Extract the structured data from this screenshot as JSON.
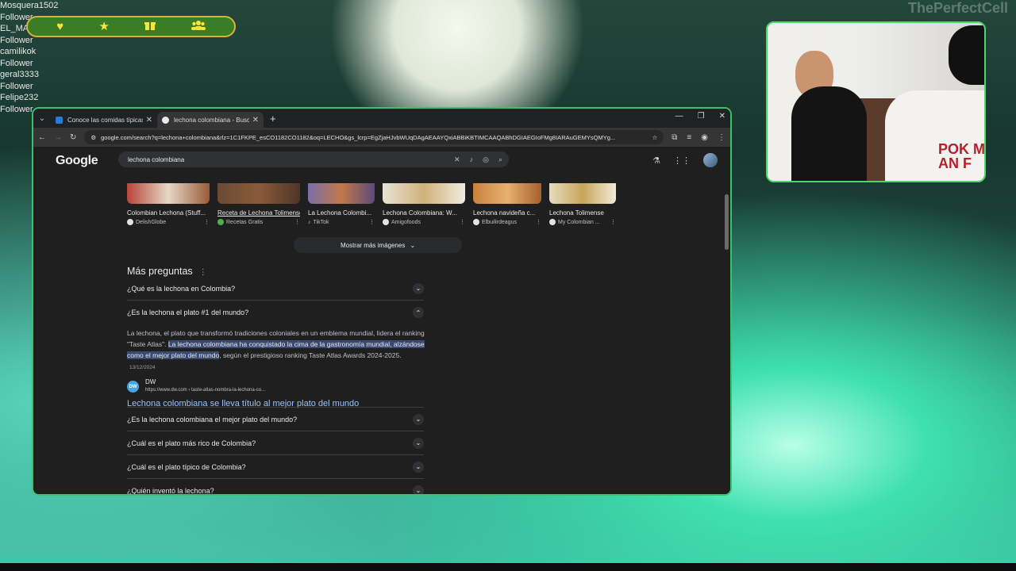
{
  "watermark": "ThePerfectCell",
  "chat": [
    "Mosquera1502",
    "Follower",
    "EL_MA",
    "Follower",
    "camilikok",
    "Follower",
    "geral3333",
    "Follower",
    "Felipe232",
    "Follower"
  ],
  "reaction_bar": {
    "icons": [
      "heart-icon",
      "star-icon",
      "gift-icon",
      "users-icon"
    ],
    "color": "#ffe23a",
    "glyphs": [
      "♥",
      "★",
      "🎁",
      "👥"
    ]
  },
  "webcam": {
    "shirt_text": "POK M\nAN F"
  },
  "browser": {
    "tabs": [
      {
        "title": "Conoce las comidas típicas de",
        "favicon_color": "#2b7bd6",
        "active": false
      },
      {
        "title": "lechona colombiana - Buscar c",
        "favicon_color": "#e8eaed",
        "active": true
      }
    ],
    "new_tab": "+",
    "window_controls": [
      "—",
      "❐",
      "✕"
    ],
    "url": "google.com/search?q=lechona+colombiana&rlz=1C1FKPE_esCO1182CO1182&oq=LECHO&gs_lcrp=EgZjaHJvbWUqDAgAEAAYQxiABBiKBTIMCAAQABhDGIAEGIoFMg8IARAuGEMYsQMYg...",
    "google": {
      "logo": "Google",
      "query": "lechona colombiana",
      "images": [
        {
          "title": "Colombian Lechona (Stuff...",
          "source": "DelishGlobe",
          "color": "#b8453a",
          "underlined": false
        },
        {
          "title": "Receta de Lechona Tolimense",
          "source": "Recetas Gratis",
          "color": "#8b5a3a",
          "underlined": true
        },
        {
          "title": "La Lechona Colombi...",
          "source": "TikTok",
          "color": "#7a6fa8",
          "underlined": false
        },
        {
          "title": "Lechona Colombiana: W...",
          "source": "Amigofoods",
          "color": "#d0b27a",
          "underlined": false
        },
        {
          "title": "Lechona navideña c...",
          "source": "Elbuilirdeagus",
          "color": "#c9823c",
          "underlined": false
        },
        {
          "title": "Lechona Tolimense",
          "source": "My Colombian ...",
          "color": "#c7a65a",
          "underlined": false
        }
      ],
      "show_more": "Mostrar más imágenes",
      "paa_title": "Más preguntas",
      "questions": [
        "¿Qué es la lechona en Colombia?",
        "¿Es la lechona el plato #1 del mundo?",
        "¿Es la lechona colombiana el mejor plato del mundo?",
        "¿Cuál es el plato más rico de Colombia?",
        "¿Cuál es el plato típico de Colombia?",
        "¿Quién inventó la lechona?"
      ],
      "answer": {
        "before": "La lechona, el plato que transformó tradiciones coloniales en un emblema mundial, lidera el ranking \"Taste Atlas\".",
        "highlight": "La lechona colombiana ha conquistado la cima de la gastronomía mundial, alzándose como el mejor plato del mundo",
        "after": ", según el prestigioso ranking Taste Atlas Awards 2024-2025.",
        "date": "13/12/2024"
      },
      "source": {
        "name": "DW",
        "url": "https://www.dw.com › taste-atlas-nombra-la-lechona-co...",
        "link": "Lechona colombiana se lleva título al mejor plato del mundo"
      }
    }
  }
}
